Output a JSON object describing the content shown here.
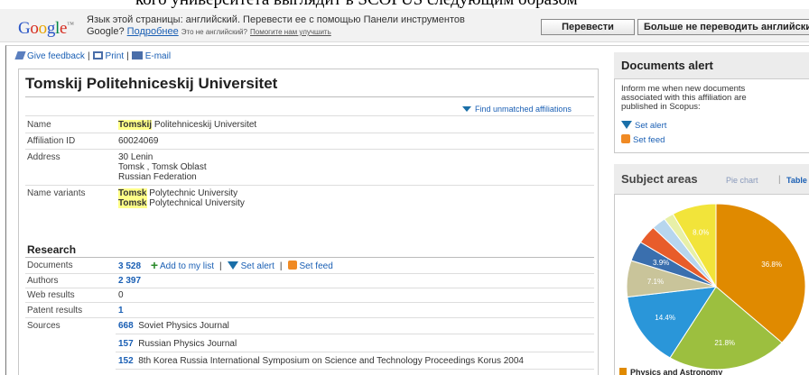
{
  "doc_caption": "кого университета выглядит в SCOPUS следующим образом",
  "translate_bar": {
    "logo": {
      "G": "G",
      "o1": "o",
      "o2": "o",
      "g": "g",
      "l": "l",
      "e": "e"
    },
    "message_line1": "Язык этой страницы: английский. Перевести ее с помощью Панели инструментов",
    "message_line2_prefix": "Google?",
    "more_link": "Подробнее",
    "not_english": "Это не английский?",
    "help_link": "Помогите нам улучшить",
    "translate_button": "Перевести",
    "never_button": "Больше не переводить английски"
  },
  "toolbar": {
    "feedback": "Give feedback",
    "print": "Print",
    "email": "E-mail"
  },
  "affiliation": {
    "title": "Tomskij Politehniceskij Universitet",
    "find_unmatched": "Find unmatched affiliations",
    "name_label": "Name",
    "name_hl": "Tomskij",
    "name_rest": " Politehniceskij Universitet",
    "id_label": "Affiliation ID",
    "id_value": "60024069",
    "address_label": "Address",
    "address_lines": [
      "30 Lenin",
      "Tomsk , Tomsk Oblast",
      "Russian Federation"
    ],
    "variants_label": "Name variants",
    "variants": [
      {
        "hl": "Tomsk",
        "rest": " Polytechnic University"
      },
      {
        "hl": "Tomsk",
        "rest": " Polytechnical University"
      }
    ]
  },
  "research": {
    "title": "Research",
    "documents_label": "Documents",
    "documents_value": "3 528",
    "add_to_list": "Add to my list",
    "set_alert": "Set alert",
    "set_feed": "Set feed",
    "authors_label": "Authors",
    "authors_value": "2 397",
    "web_label": "Web results",
    "web_value": "0",
    "patent_label": "Patent results",
    "patent_value": "1",
    "sources_label": "Sources",
    "sources": [
      {
        "count": "668",
        "name": "Soviet Physics Journal"
      },
      {
        "count": "157",
        "name": "Russian Physics Journal"
      },
      {
        "count": "152",
        "name": "8th Korea Russia International Symposium on Science and Technology Proceedings Korus 2004"
      }
    ]
  },
  "documents_alert": {
    "title": "Documents alert",
    "text": "Inform me when new documents associated with this affiliation are published in Scopus:",
    "set_alert": "Set alert",
    "set_feed": "Set feed"
  },
  "subject_areas": {
    "title": "Subject areas",
    "pie_chart_link": "Pie chart",
    "separator": "|",
    "table_link": "Table",
    "legend_first": "Physics and Astronomy"
  },
  "chart_data": {
    "type": "pie",
    "slices": [
      {
        "value": 36.8,
        "label": "36.8%",
        "color": "#e08a00"
      },
      {
        "value": 21.8,
        "label": "21.8%",
        "color": "#9cbf3f"
      },
      {
        "value": 14.4,
        "label": "14.4%",
        "color": "#2a96d9"
      },
      {
        "value": 7.1,
        "label": "7.1%",
        "color": "#c9c49a"
      },
      {
        "value": 3.9,
        "label": "3.9%",
        "color": "#3a6fae"
      },
      {
        "value": 3.6,
        "label": "",
        "color": "#e85c2a"
      },
      {
        "value": 2.6,
        "label": "",
        "color": "#b7d6ee"
      },
      {
        "value": 1.8,
        "label": "",
        "color": "#e8f0a8"
      },
      {
        "value": 8.0,
        "label": "8.0%",
        "color": "#f2e43a"
      }
    ]
  }
}
